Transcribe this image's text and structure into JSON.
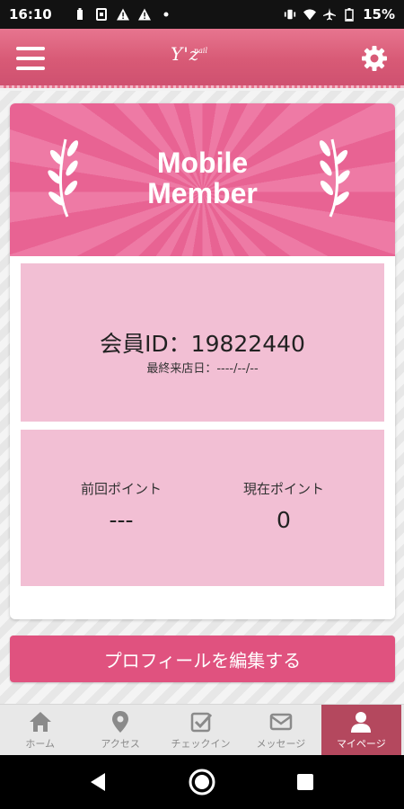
{
  "status_bar": {
    "time": "16:10",
    "battery": "15%"
  },
  "header": {
    "brand": "Y'z",
    "brand_sub": "nail"
  },
  "hero": {
    "line1": "Mobile",
    "line2": "Member"
  },
  "member": {
    "id_label": "会員ID：19822440",
    "last_visit": "最終来店日：----/--/--"
  },
  "points": {
    "previous_label": "前回ポイント",
    "previous_value": "---",
    "current_label": "現在ポイント",
    "current_value": "0"
  },
  "edit_profile_label": "プロフィールを編集する",
  "bottom_nav": [
    {
      "label": "ホーム",
      "icon": "home-icon"
    },
    {
      "label": "アクセス",
      "icon": "map-pin-icon"
    },
    {
      "label": "チェックイン",
      "icon": "checkbox-icon"
    },
    {
      "label": "メッセージ",
      "icon": "envelope-icon"
    },
    {
      "label": "マイページ",
      "icon": "user-icon"
    }
  ],
  "colors": {
    "brand": "#d85a76",
    "accent": "#e0527f",
    "panel": "#f2bfd4",
    "nav_active": "#b4485e"
  }
}
